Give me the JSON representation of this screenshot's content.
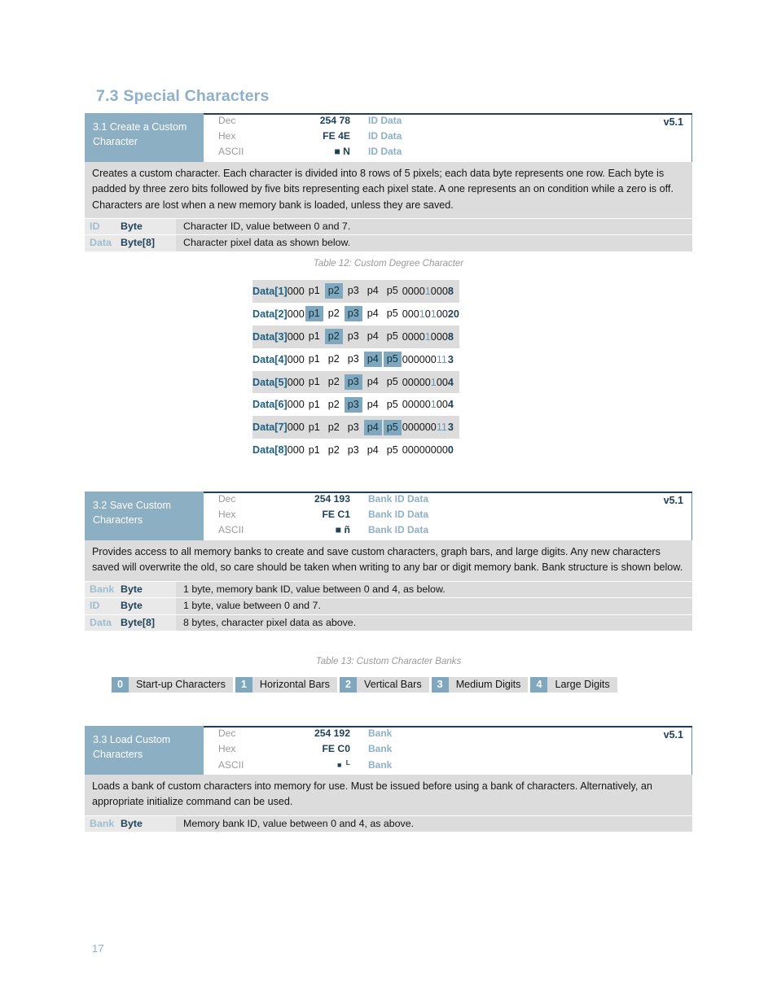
{
  "page": {
    "section_title": "7.3 Special Characters",
    "page_number": "17"
  },
  "commands": [
    {
      "name_line1": "3.1 Create a Custom",
      "name_line2": "Character",
      "version": "v5.1",
      "rows": [
        {
          "label": "Dec",
          "value": "254 78",
          "params": "ID Data"
        },
        {
          "label": "Hex",
          "value": "FE 4E",
          "params": "ID Data"
        },
        {
          "label": "ASCII",
          "value": "■ N",
          "params": "ID Data"
        }
      ],
      "description": "Creates a custom character.  Each character is divided into 8 rows of 5 pixels; each data byte represents one row.  Each byte is padded by three zero bits followed by five bits representing each pixel state.  A one represents an on condition while a zero is off.  Characters are lost when a new memory bank is loaded, unless they are saved.",
      "parameters": [
        {
          "name": "ID",
          "type": "Byte",
          "desc": "Character ID, value between 0 and 7."
        },
        {
          "name": "Data",
          "type": "Byte[8]",
          "desc": "Character pixel data as shown below."
        }
      ]
    },
    {
      "name_line1": "3.2 Save Custom",
      "name_line2": "Characters",
      "version": "v5.1",
      "rows": [
        {
          "label": "Dec",
          "value": "254 193",
          "params": "Bank ID Data"
        },
        {
          "label": "Hex",
          "value": "FE C1",
          "params": "Bank ID Data"
        },
        {
          "label": "ASCII",
          "value": "■ ñ",
          "params": "Bank ID Data"
        }
      ],
      "description": "Provides access to all memory banks to create and save custom characters, graph bars, and large digits.  Any new characters saved will overwrite the old, so care should be taken when writing to any bar or digit memory bank.  Bank structure is shown below.",
      "parameters": [
        {
          "name": "Bank",
          "type": "Byte",
          "desc": "1 byte, memory bank ID, value between 0 and 4, as below."
        },
        {
          "name": "ID",
          "type": "Byte",
          "desc": "1 byte, value between 0 and 7."
        },
        {
          "name": "Data",
          "type": "Byte[8]",
          "desc": "8 bytes, character pixel data as above."
        }
      ]
    },
    {
      "name_line1": "3.3 Load Custom",
      "name_line2": "Characters",
      "version": "v5.1",
      "rows": [
        {
          "label": "Dec",
          "value": "254 192",
          "params": "Bank"
        },
        {
          "label": "Hex",
          "value": "FE C0",
          "params": "Bank"
        },
        {
          "label": "ASCII",
          "value": "■ L",
          "params": "Bank"
        }
      ],
      "description": "Loads a bank of custom characters into memory for use.  Must be issued before using a bank of characters.  Alternatively, an appropriate initialize command can be used.",
      "parameters": [
        {
          "name": "Bank",
          "type": "Byte",
          "desc": "Memory bank ID, value between 0 and 4, as above."
        }
      ]
    }
  ],
  "table12": {
    "caption": "Table 12: Custom Degree Character",
    "pixel_headers": [
      "p1",
      "p2",
      "p3",
      "p4",
      "p5"
    ],
    "pad": "000",
    "rows": [
      {
        "label": "Data[1]",
        "pixels": [
          0,
          1,
          0,
          0,
          0
        ],
        "binary": "00001000",
        "decimal": "8"
      },
      {
        "label": "Data[2]",
        "pixels": [
          1,
          0,
          1,
          0,
          0
        ],
        "binary": "00010100",
        "decimal": "20"
      },
      {
        "label": "Data[3]",
        "pixels": [
          0,
          1,
          0,
          0,
          0
        ],
        "binary": "00001000",
        "decimal": "8"
      },
      {
        "label": "Data[4]",
        "pixels": [
          0,
          0,
          0,
          1,
          1
        ],
        "binary": "00000011",
        "decimal": "3"
      },
      {
        "label": "Data[5]",
        "pixels": [
          0,
          0,
          1,
          0,
          0
        ],
        "binary": "00000100",
        "decimal": "4"
      },
      {
        "label": "Data[6]",
        "pixels": [
          0,
          0,
          1,
          0,
          0
        ],
        "binary": "00000100",
        "decimal": "4"
      },
      {
        "label": "Data[7]",
        "pixels": [
          0,
          0,
          0,
          1,
          1
        ],
        "binary": "00000011",
        "decimal": "3"
      },
      {
        "label": "Data[8]",
        "pixels": [
          0,
          0,
          0,
          0,
          0
        ],
        "binary": "00000000",
        "decimal": "0"
      }
    ]
  },
  "table13": {
    "caption": "Table 13: Custom Character Banks",
    "banks": [
      {
        "id": "0",
        "label": "Start-up Characters"
      },
      {
        "id": "1",
        "label": "Horizontal Bars"
      },
      {
        "id": "2",
        "label": "Vertical Bars"
      },
      {
        "id": "3",
        "label": "Medium Digits"
      },
      {
        "id": "4",
        "label": "Large Digits"
      }
    ]
  },
  "colors": {
    "accent_header": "#8CAFC4",
    "accent_dark": "#1F4258",
    "highlight": "#7FA8BE",
    "row_shade": "#DCDCDC",
    "title": "#8EB0C8"
  }
}
